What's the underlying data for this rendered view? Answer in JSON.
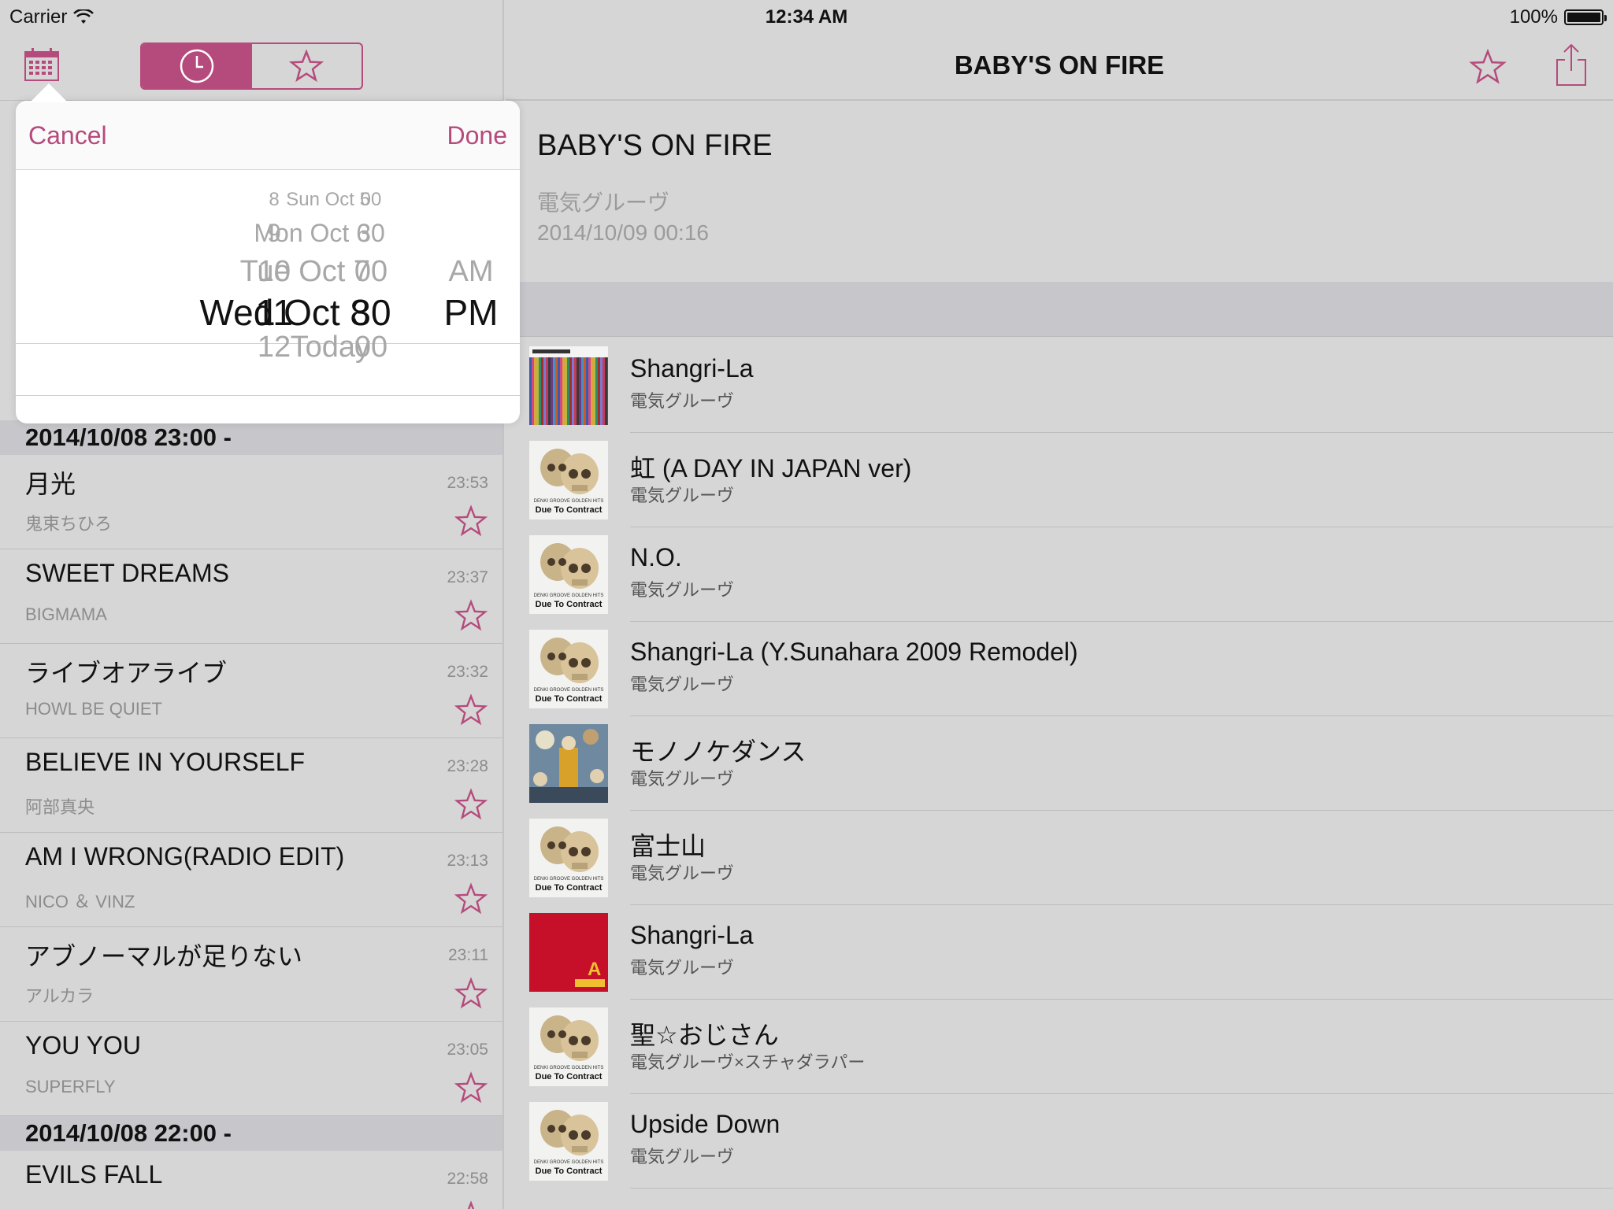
{
  "status": {
    "carrier": "Carrier",
    "time": "12:34 AM",
    "battery": "100%"
  },
  "accent_color": "#b54b7c",
  "left": {
    "segments": [
      {
        "icon": "clock-icon",
        "active": true
      },
      {
        "icon": "star-icon",
        "active": false
      }
    ],
    "sections": [
      {
        "header": "2014/10/08 23:00 -",
        "tracks": [
          {
            "title": "月光",
            "artist": "鬼束ちひろ",
            "time": "23:53"
          },
          {
            "title": "SWEET DREAMS",
            "artist": "BIGMAMA",
            "time": "23:37"
          },
          {
            "title": "ライブオアライブ",
            "artist": "HOWL BE QUIET",
            "time": "23:32"
          },
          {
            "title": "BELIEVE IN YOURSELF",
            "artist": "阿部真央",
            "time": "23:28"
          },
          {
            "title": "AM I WRONG(RADIO EDIT)",
            "artist": "NICO ＆ VINZ",
            "time": "23:13"
          },
          {
            "title": "アブノーマルが足りない",
            "artist": "アルカラ",
            "time": "23:11"
          },
          {
            "title": "YOU YOU",
            "artist": "SUPERFLY",
            "time": "23:05"
          }
        ]
      },
      {
        "header": "2014/10/08 22:00 -",
        "tracks": [
          {
            "title": "EVILS FALL",
            "artist": "",
            "time": "22:58"
          }
        ]
      }
    ]
  },
  "picker": {
    "cancel_label": "Cancel",
    "done_label": "Done",
    "dates": [
      "Sun Oct 5",
      "Mon Oct 6",
      "Tue Oct 7",
      "Wed Oct 8",
      "Today"
    ],
    "hours": [
      "8",
      "9",
      "10",
      "11",
      "12"
    ],
    "minutes": [
      "00",
      "30",
      "00",
      "30",
      "00"
    ],
    "ampm": [
      "AM",
      "PM"
    ],
    "selected": {
      "date": "Wed Oct 8",
      "hour": "11",
      "minute": "30",
      "ampm": "PM"
    }
  },
  "right": {
    "nav_title": "BABY'S ON FIRE",
    "song": {
      "title": "BABY'S ON FIRE",
      "artist": "電気グルーヴ",
      "date": "2014/10/09 00:16"
    },
    "related": [
      {
        "title": "Shangri-La",
        "artist": "電気グルーヴ",
        "art": "striped-cover"
      },
      {
        "title": "虹 (A DAY IN JAPAN ver)",
        "artist": "電気グルーヴ",
        "art": "skulls-cover"
      },
      {
        "title": "N.O.",
        "artist": "電気グルーヴ",
        "art": "skulls-cover"
      },
      {
        "title": "Shangri-La (Y.Sunahara 2009 Remodel)",
        "artist": "電気グルーヴ",
        "art": "skulls-cover"
      },
      {
        "title": "モノノケダンス",
        "artist": "電気グルーヴ",
        "art": "illustration-cover"
      },
      {
        "title": "富士山",
        "artist": "電気グルーヴ",
        "art": "skulls-cover"
      },
      {
        "title": "Shangri-La",
        "artist": "電気グルーヴ",
        "art": "red-a-cover"
      },
      {
        "title": "聖☆おじさん",
        "artist": "電気グルーヴ×スチャダラパー",
        "art": "skulls-cover"
      },
      {
        "title": "Upside Down",
        "artist": "電気グルーヴ",
        "art": "skulls-cover"
      }
    ],
    "cover_text": {
      "skulls_line1": "DENKI GROOVE GOLDEN HITS",
      "skulls_line2": "Due To Contract",
      "red_letter": "A"
    }
  }
}
